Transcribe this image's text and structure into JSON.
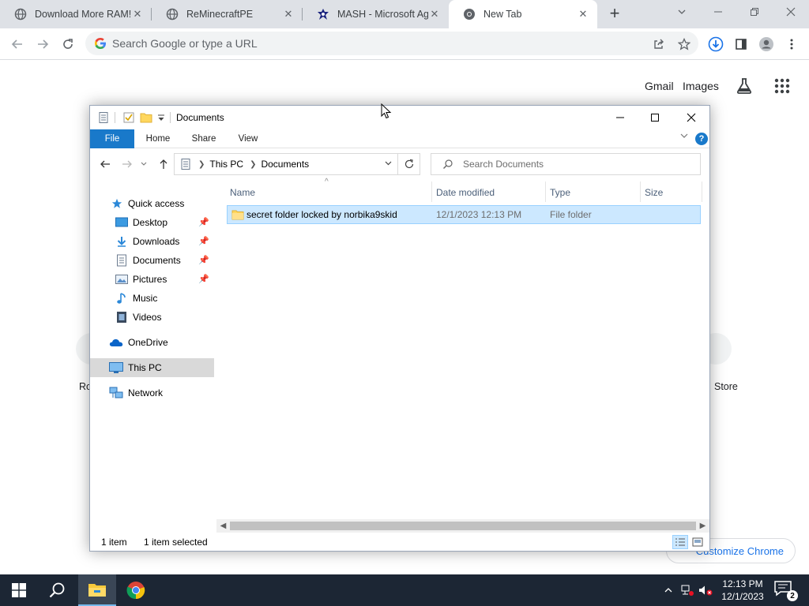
{
  "browser": {
    "tabs": [
      {
        "title": "Download More RAM!",
        "icon": "globe-icon"
      },
      {
        "title": "ReMinecraftPE",
        "icon": "globe-icon"
      },
      {
        "title": "MASH - Microsoft Agent",
        "icon": "mash-icon"
      },
      {
        "title": "New Tab",
        "icon": "chrome-icon",
        "active": true
      }
    ],
    "close_glyph": "✕",
    "new_tab_glyph": "+",
    "omnibox_placeholder": "Search Google or type a URL",
    "ntp": {
      "gmail": "Gmail",
      "images": "Images",
      "shortcut_left_partial": "Rc",
      "shortcut_right_partial": "Store",
      "customize": "Customize Chrome"
    }
  },
  "explorer": {
    "title": "Documents",
    "ribbon_tabs": [
      "File",
      "Home",
      "Share",
      "View"
    ],
    "help": "?",
    "breadcrumb": [
      "This PC",
      "Documents"
    ],
    "search_placeholder": "Search Documents",
    "nav_items": [
      {
        "label": "Quick access",
        "icon": "star-icon",
        "pinned": false
      },
      {
        "label": "Desktop",
        "icon": "desktop-icon",
        "pinned": true
      },
      {
        "label": "Downloads",
        "icon": "download-icon",
        "pinned": true
      },
      {
        "label": "Documents",
        "icon": "documents-icon",
        "pinned": true
      },
      {
        "label": "Pictures",
        "icon": "pictures-icon",
        "pinned": true
      },
      {
        "label": "Music",
        "icon": "music-icon",
        "pinned": false
      },
      {
        "label": "Videos",
        "icon": "videos-icon",
        "pinned": false
      },
      {
        "label": "OneDrive",
        "icon": "cloud-icon",
        "pinned": false
      },
      {
        "label": "This PC",
        "icon": "computer-icon",
        "pinned": false,
        "selected": true
      },
      {
        "label": "Network",
        "icon": "network-icon",
        "pinned": false
      }
    ],
    "columns": [
      "Name",
      "Date modified",
      "Type",
      "Size"
    ],
    "files": [
      {
        "name": "secret folder locked by norbika9skid",
        "date": "12/1/2023 12:13 PM",
        "type": "File folder",
        "size": ""
      }
    ],
    "status": {
      "count": "1 item",
      "selected": "1 item selected"
    }
  },
  "taskbar": {
    "time": "12:13 PM",
    "date": "12/1/2023",
    "notification_count": "2"
  },
  "colors": {
    "accent": "#1979ca",
    "selection": "#cce8ff",
    "taskbar": "#1c2634"
  }
}
